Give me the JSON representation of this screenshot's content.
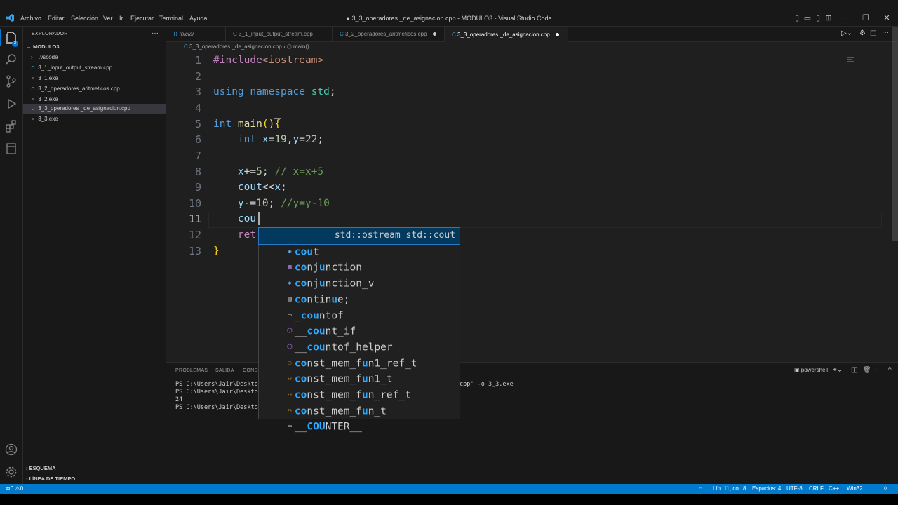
{
  "titlebar": {
    "menu": [
      "Archivo",
      "Editar",
      "Selección",
      "Ver",
      "Ir",
      "Ejecutar",
      "Terminal",
      "Ayuda"
    ],
    "title": "● 3_3_operadores _de_asignacion.cpp - MODULO3 - Visual Studio Code"
  },
  "sidebar": {
    "header": "EXPLORADOR",
    "folder": "MODULO3",
    "items": [
      {
        "label": ".vscode",
        "type": "folder"
      },
      {
        "label": "3_1_input_output_stream.cpp",
        "type": "cpp"
      },
      {
        "label": "3_1.exe",
        "type": "exe"
      },
      {
        "label": "3_2_operadores_aritmeticos.cpp",
        "type": "cpp"
      },
      {
        "label": "3_2.exe",
        "type": "exe"
      },
      {
        "label": "3_3_operadores _de_asignacion.cpp",
        "type": "cpp"
      },
      {
        "label": "3_3.exe",
        "type": "exe"
      }
    ],
    "outline": "ESQUEMA",
    "timeline": "LÍNEA DE TIEMPO"
  },
  "tabs": [
    {
      "label": "Iniciar"
    },
    {
      "label": "3_1_input_output_stream.cpp"
    },
    {
      "label": "3_2_operadores_aritmeticos.cpp"
    },
    {
      "label": "3_3_operadores _de_asignacion.cpp"
    }
  ],
  "breadcrumb": {
    "file": "3_3_operadores _de_asignacion.cpp",
    "symbol": "main()"
  },
  "editor": {
    "line_numbers": [
      "1",
      "2",
      "3",
      "4",
      "5",
      "6",
      "7",
      "8",
      "9",
      "10",
      "11",
      "12",
      "13"
    ],
    "line1": {
      "a": "#include",
      "b": "<iostream>"
    },
    "line3": {
      "a": "using",
      "b": " namespace",
      "c": " std",
      "d": ";"
    },
    "line5": {
      "a": "int",
      "b": " main",
      "c": "()",
      "d": "{"
    },
    "line6": {
      "a": "    int",
      "b": " x",
      "c": "=",
      "d": "19",
      "e": ",",
      "f": "y",
      "g": "=",
      "h": "22",
      "i": ";"
    },
    "line8": {
      "a": "    x",
      "b": "+=",
      "c": "5",
      "d": "; ",
      "e": "// x=x+5"
    },
    "line9": {
      "a": "    cout",
      "b": "<<",
      "c": "x",
      "d": ";"
    },
    "line10": {
      "a": "    y",
      "b": "-=",
      "c": "10",
      "d": "; ",
      "e": "//y=y-10"
    },
    "line11": {
      "a": "    cou"
    },
    "line12": {
      "a": "    ret"
    },
    "line13": {
      "a": "}"
    }
  },
  "suggest": {
    "items": [
      {
        "icon": "variable-icon",
        "pre": "",
        "hl": "cou",
        "post": "t",
        "detail": "std::ostream std::cout"
      },
      {
        "icon": "struct-icon",
        "pre": "",
        "hl": "co",
        "post": "nj",
        "hl2": "u",
        "post2": "nction"
      },
      {
        "icon": "variable-icon",
        "pre": "",
        "hl": "co",
        "post": "nj",
        "hl2": "u",
        "post2": "nction_v"
      },
      {
        "icon": "keyword-icon",
        "pre": "",
        "hl": "co",
        "post": "ntin",
        "hl2": "u",
        "post2": "e;"
      },
      {
        "icon": "text-icon",
        "pre": "_",
        "hl": "cou",
        "post": "ntof"
      },
      {
        "icon": "function-icon",
        "pre": "__",
        "hl": "cou",
        "post": "nt_if"
      },
      {
        "icon": "function-icon",
        "pre": "__",
        "hl": "cou",
        "post": "ntof_helper"
      },
      {
        "icon": "class-icon",
        "pre": "",
        "hl": "co",
        "post": "nst_mem_f",
        "hl2": "u",
        "post2": "n1_ref_t"
      },
      {
        "icon": "class-icon",
        "pre": "",
        "hl": "co",
        "post": "nst_mem_f",
        "hl2": "u",
        "post2": "n1_t"
      },
      {
        "icon": "class-icon",
        "pre": "",
        "hl": "co",
        "post": "nst_mem_f",
        "hl2": "u",
        "post2": "n_ref_t"
      },
      {
        "icon": "class-icon",
        "pre": "",
        "hl": "co",
        "post": "nst_mem_f",
        "hl2": "u",
        "post2": "n_t"
      },
      {
        "icon": "text-icon",
        "pre": "__",
        "hl": "COU",
        "post": "NTER__"
      }
    ]
  },
  "panel": {
    "tabs": [
      "PROBLEMAS",
      "SALIDA",
      "CONSO"
    ],
    "shell": "powershell",
    "terminal": [
      "PS C:\\Users\\Jair\\Desktop\\",
      "PS C:\\Users\\Jair\\Desktop\\",
      "24",
      "PS C:\\Users\\Jair\\Desktop\\"
    ],
    "terminal_tail": "cpp' -o 3_3.exe"
  },
  "statusbar": {
    "errors": "0",
    "warnings": "0",
    "position": "Lín. 11, col. 8",
    "spaces": "Espacios: 4",
    "encoding": "UTF-8",
    "eol": "CRLF",
    "language": "C++",
    "platform": "Win32"
  }
}
